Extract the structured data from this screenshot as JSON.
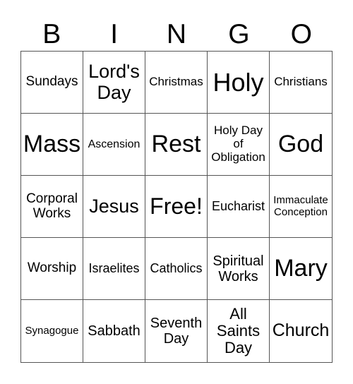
{
  "header": [
    "B",
    "I",
    "N",
    "G",
    "O"
  ],
  "cells": [
    [
      "Sundays",
      "Lord's Day",
      "Christmas",
      "Holy",
      "Christians"
    ],
    [
      "Mass",
      "Ascension",
      "Rest",
      "Holy Day of Obligation",
      "God"
    ],
    [
      "Corporal Works",
      "Jesus",
      "Free!",
      "Eucharist",
      "Immaculate Conception"
    ],
    [
      "Worship",
      "Israelites",
      "Catholics",
      "Spiritual Works",
      "Mary"
    ],
    [
      "Synagogue",
      "Sabbath",
      "Seventh Day",
      "All Saints Day",
      "Church"
    ]
  ]
}
